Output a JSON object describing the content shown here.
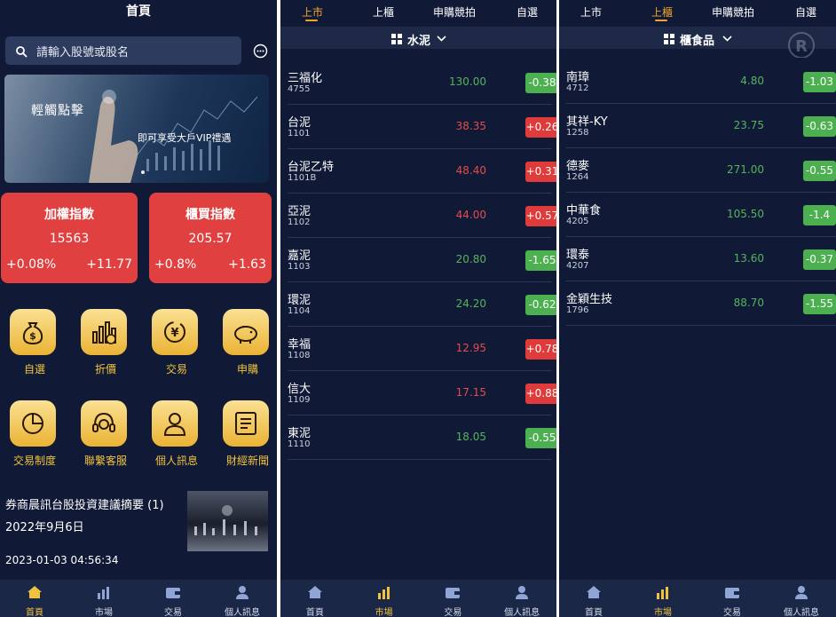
{
  "home": {
    "title": "首頁",
    "search_placeholder": "請輸入股號或股名",
    "banner": {
      "line1": "輕觸點擊",
      "line2": "即可享受大戶VIP禮遇"
    },
    "indices": [
      {
        "name": "加權指數",
        "value": "15563",
        "pct": "+0.08%",
        "change": "+11.77"
      },
      {
        "name": "櫃買指數",
        "value": "205.57",
        "pct": "+0.8%",
        "change": "+1.63"
      }
    ],
    "quick_items": [
      {
        "label": "自選",
        "icon": "money-bag-icon"
      },
      {
        "label": "折價",
        "icon": "bar-chart-icon"
      },
      {
        "label": "交易",
        "icon": "yen-exchange-icon"
      },
      {
        "label": "申購",
        "icon": "piggy-bank-icon"
      },
      {
        "label": "交易制度",
        "icon": "pie-chart-icon"
      },
      {
        "label": "聯繫客服",
        "icon": "headset-icon"
      },
      {
        "label": "個人訊息",
        "icon": "user-icon"
      },
      {
        "label": "財經新聞",
        "icon": "newspaper-icon"
      }
    ],
    "news": {
      "title": "券商晨訊台股投資建議摘要 (1)",
      "date": "2022年9月6日",
      "time": "2023-01-03 04:56:34"
    }
  },
  "tabbar": [
    {
      "label": "首頁",
      "icon": "home-icon"
    },
    {
      "label": "市場",
      "icon": "market-icon"
    },
    {
      "label": "交易",
      "icon": "wallet-icon"
    },
    {
      "label": "個人訊息",
      "icon": "person-icon"
    }
  ],
  "market_tabs": [
    "上市",
    "上櫃",
    "申購競拍",
    "自選"
  ],
  "listed": {
    "category": "水泥",
    "stocks": [
      {
        "name": "三福化",
        "code": "4755",
        "price": "130.00",
        "change": "-0.38",
        "dir": "dn"
      },
      {
        "name": "台泥",
        "code": "1101",
        "price": "38.35",
        "change": "+0.26",
        "dir": "up"
      },
      {
        "name": "台泥乙特",
        "code": "1101B",
        "price": "48.40",
        "change": "+0.31",
        "dir": "up"
      },
      {
        "name": "亞泥",
        "code": "1102",
        "price": "44.00",
        "change": "+0.57",
        "dir": "up"
      },
      {
        "name": "嘉泥",
        "code": "1103",
        "price": "20.80",
        "change": "-1.65",
        "dir": "dn"
      },
      {
        "name": "環泥",
        "code": "1104",
        "price": "24.20",
        "change": "-0.62",
        "dir": "dn"
      },
      {
        "name": "幸福",
        "code": "1108",
        "price": "12.95",
        "change": "+0.78",
        "dir": "up"
      },
      {
        "name": "信大",
        "code": "1109",
        "price": "17.15",
        "change": "+0.88",
        "dir": "up"
      },
      {
        "name": "東泥",
        "code": "1110",
        "price": "18.05",
        "change": "-0.55",
        "dir": "dn"
      }
    ]
  },
  "otc": {
    "category": "櫃食品",
    "stocks": [
      {
        "name": "南璋",
        "code": "4712",
        "price": "4.80",
        "change": "-1.03",
        "dir": "dn"
      },
      {
        "name": "其祥-KY",
        "code": "1258",
        "price": "23.75",
        "change": "-0.63",
        "dir": "dn"
      },
      {
        "name": "德麥",
        "code": "1264",
        "price": "271.00",
        "change": "-0.55",
        "dir": "dn"
      },
      {
        "name": "中華食",
        "code": "4205",
        "price": "105.50",
        "change": "-1.4",
        "dir": "dn"
      },
      {
        "name": "環泰",
        "code": "4207",
        "price": "13.60",
        "change": "-0.37",
        "dir": "dn"
      },
      {
        "name": "金穎生技",
        "code": "1796",
        "price": "88.70",
        "change": "-1.55",
        "dir": "dn"
      }
    ]
  },
  "colors": {
    "background": "#101a36",
    "accent": "#f0c23e",
    "up": "#e03b3b",
    "down": "#4cb050",
    "index_card": "#e0403f"
  }
}
